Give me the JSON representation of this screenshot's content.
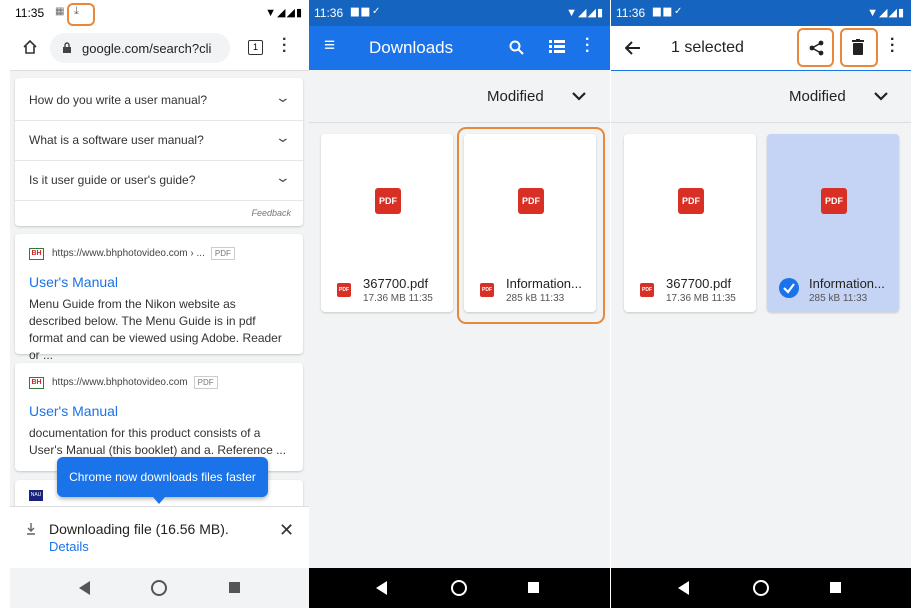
{
  "left": {
    "time": "11:35",
    "tab_count": "1",
    "url": "google.com/search?cli",
    "faq": [
      "How do you write a user manual?",
      "What is a software user manual?",
      "Is it user guide or user's guide?"
    ],
    "feedback": "Feedback",
    "results": [
      {
        "favicon": "BH",
        "site": "https://www.bhphotovideo.com › ...",
        "tag": "PDF",
        "title": "User's Manual",
        "snippet": "Menu Guide from the Nikon website as described below. The Menu Guide is in pdf format and can be viewed using Adobe. Reader or ..."
      },
      {
        "favicon": "BH",
        "site": "https://www.bhphotovideo.com",
        "tag": "PDF",
        "title": "User's Manual",
        "snippet": "documentation for this product consists of a User's Manual (this booklet) and a. Reference ..."
      }
    ],
    "third_result_favicon": "NAU",
    "tooltip": "Chrome now downloads files faster",
    "download_text": "Downloading file (16.56 MB).",
    "details_link": "Details"
  },
  "middle": {
    "time": "11:36",
    "title": "Downloads",
    "sort_label": "Modified",
    "files": [
      {
        "name": "367700.pdf",
        "meta": "17.36 MB 11:35"
      },
      {
        "name": "Information...",
        "meta": "285 kB 11:33"
      }
    ]
  },
  "right": {
    "time": "11:36",
    "selected_text": "1 selected",
    "sort_label": "Modified",
    "files": [
      {
        "name": "367700.pdf",
        "meta": "17.36 MB 11:35"
      },
      {
        "name": "Information...",
        "meta": "285 kB 11:33"
      }
    ]
  },
  "pdf_badge": "PDF",
  "colors": {
    "highlight": "#e8883a",
    "app_blue": "#1a73e8",
    "selected_bg": "#c5d4f5",
    "pdf_red": "#d93025"
  },
  "icons": [
    "home-icon",
    "lock-icon",
    "more-vert-icon",
    "menu-icon",
    "search-icon",
    "list-view-icon",
    "back-arrow-icon",
    "share-icon",
    "delete-icon",
    "check-icon",
    "download-icon",
    "close-icon"
  ]
}
